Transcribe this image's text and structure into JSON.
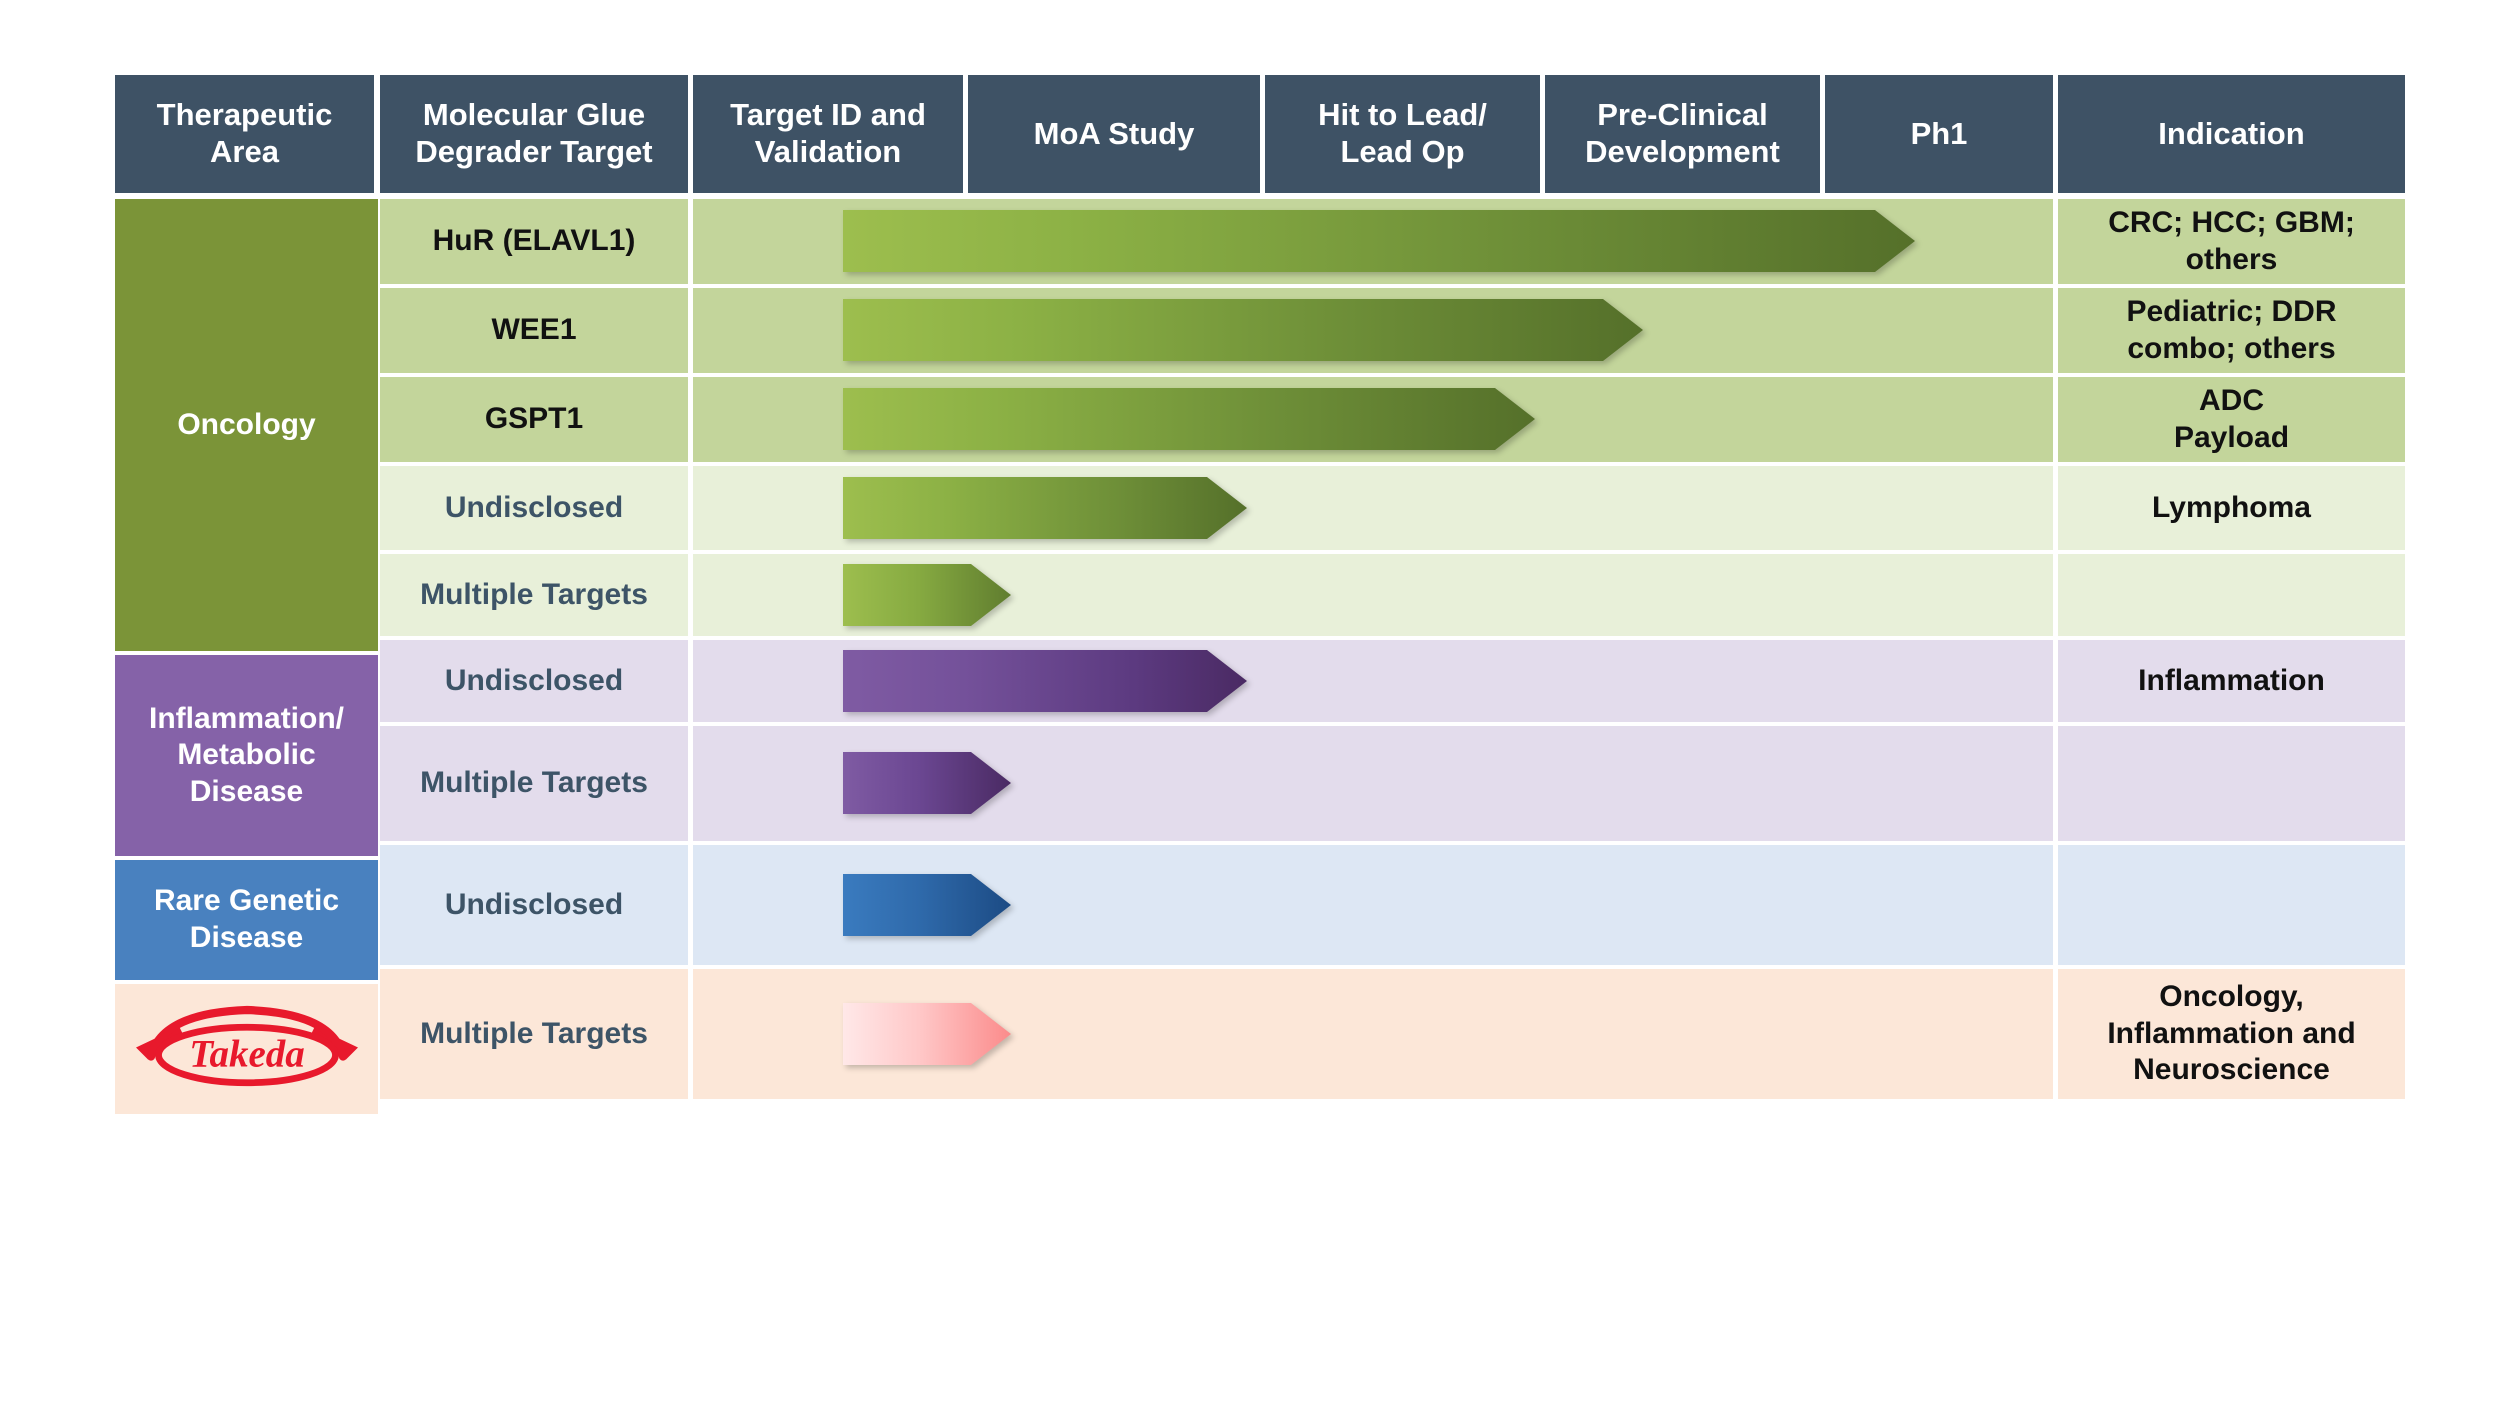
{
  "chart_data": {
    "type": "table",
    "title": "Molecular Glue Degrader Pipeline",
    "stage_columns": [
      "Target ID and Validation",
      "MoA Study",
      "Hit to Lead/ Lead Op",
      "Pre-Clinical Development",
      "Ph1"
    ],
    "rows": [
      {
        "therapeutic_area": "Oncology",
        "target": "HuR (ELAVL1)",
        "progress_stage": "Pre-Clinical Development",
        "progress_fraction": 0.94,
        "indication": "CRC; HCC; GBM; others"
      },
      {
        "therapeutic_area": "Oncology",
        "target": "WEE1",
        "progress_stage": "Hit to Lead/ Lead Op",
        "progress_fraction": 0.72,
        "indication": "Pediatric; DDR combo; others"
      },
      {
        "therapeutic_area": "Oncology",
        "target": "GSPT1",
        "progress_stage": "Hit to Lead/ Lead Op",
        "progress_fraction": 0.6,
        "indication": "ADC Payload"
      },
      {
        "therapeutic_area": "Oncology",
        "target": "Undisclosed",
        "progress_stage": "MoA Study",
        "progress_fraction": 0.34,
        "indication": "Lymphoma"
      },
      {
        "therapeutic_area": "Oncology",
        "target": "Multiple Targets",
        "progress_stage": "Target ID and Validation",
        "progress_fraction": 0.15,
        "indication": ""
      },
      {
        "therapeutic_area": "Inflammation/ Metabolic Disease",
        "target": "Undisclosed",
        "progress_stage": "MoA Study",
        "progress_fraction": 0.34,
        "indication": "Inflammation"
      },
      {
        "therapeutic_area": "Inflammation/ Metabolic Disease",
        "target": "Multiple Targets",
        "progress_stage": "Target ID and Validation",
        "progress_fraction": 0.15,
        "indication": ""
      },
      {
        "therapeutic_area": "Rare Genetic Disease",
        "target": "Undisclosed",
        "progress_stage": "Target ID and Validation",
        "progress_fraction": 0.15,
        "indication": ""
      },
      {
        "therapeutic_area": "Takeda",
        "target": "Multiple Targets",
        "progress_stage": "Target ID and Validation",
        "progress_fraction": 0.15,
        "indication": "Oncology, Inflammation and Neuroscience"
      }
    ]
  },
  "colors": {
    "header_bg": "#3e5265",
    "header_text": "#ffffff",
    "oncology_area": "#7b9438",
    "oncology_row_strong": "#c3d59b",
    "oncology_row_light": "#e8f0d9",
    "inflammation_area": "#8562a8",
    "inflammation_row": "#e3dcec",
    "rare_area": "#4981bf",
    "rare_row": "#dde7f4",
    "takeda_row": "#fce7d8",
    "takeda_red": "#e8192c",
    "label_dark": "#3d5467",
    "green_bar_start": "#9dbe4e",
    "green_bar_end": "#55702a",
    "purple_bar_start": "#7f5ba3",
    "purple_bar_end": "#4a2a63",
    "blue_bar_start": "#3a7bbf",
    "blue_bar_end": "#1c4b84",
    "pink_bar_start": "#ffe2e2",
    "pink_bar_end": "#fb8b8b"
  },
  "header": {
    "columns": [
      {
        "label": "Therapeutic Area"
      },
      {
        "label": "Molecular Glue Degrader Target"
      },
      {
        "label": "Target ID and Validation"
      },
      {
        "label": "MoA Study"
      },
      {
        "label": "Hit to Lead/ Lead Op"
      },
      {
        "label": "Pre-Clinical Development"
      },
      {
        "label": "Ph1"
      },
      {
        "label": "Indication"
      }
    ],
    "c0_l1": "Therapeutic",
    "c0_l2": "Area",
    "c1_l1": "Molecular Glue",
    "c1_l2": "Degrader Target",
    "c2_l1": "Target ID and",
    "c2_l2": "Validation",
    "c3_l1": "MoA Study",
    "c4_l1": "Hit to Lead/",
    "c4_l2": "Lead Op",
    "c5_l1": "Pre-Clinical",
    "c5_l2": "Development",
    "c6_l1": "Ph1",
    "c7_l1": "Indication"
  },
  "areas": {
    "oncology": "Oncology",
    "inflammation_l1": "Inflammation/",
    "inflammation_l2": "Metabolic",
    "inflammation_l3": "Disease",
    "rare_l1": "Rare Genetic",
    "rare_l2": "Disease",
    "takeda_logo_text": "Takeda"
  },
  "targets": {
    "hur": "HuR (ELAVL1)",
    "wee1": "WEE1",
    "gspt1": "GSPT1",
    "onc_undisclosed": "Undisclosed",
    "onc_multiple": "Multiple Targets",
    "infl_undisclosed": "Undisclosed",
    "infl_multiple": "Multiple Targets",
    "rare_undisclosed": "Undisclosed",
    "takeda_multiple": "Multiple Targets"
  },
  "indications": {
    "hur_l1": "CRC; HCC; GBM;",
    "hur_l2": "others",
    "wee1_l1": "Pediatric; DDR",
    "wee1_l2": "combo; others",
    "gspt1_l1": "ADC",
    "gspt1_l2": "Payload",
    "onc_undisclosed": "Lymphoma",
    "onc_multiple": "",
    "infl_undisclosed": "Inflammation",
    "infl_multiple": "",
    "rare_undisclosed": "",
    "takeda_l1": "Oncology,",
    "takeda_l2": "Inflammation and",
    "takeda_l3": "Neuroscience"
  }
}
